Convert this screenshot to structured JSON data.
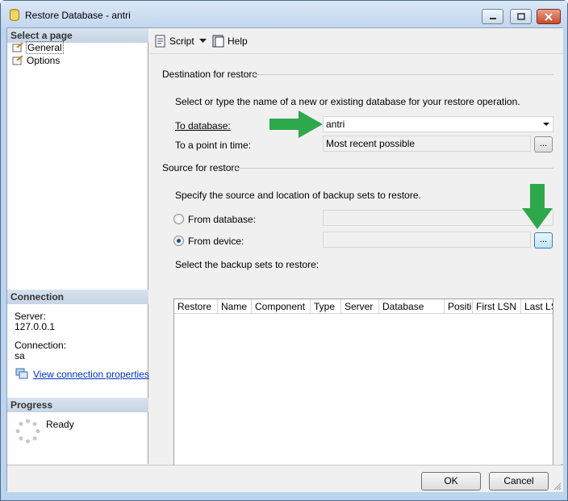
{
  "window": {
    "title": "Restore Database - antri"
  },
  "sidebar": {
    "select_page_header": "Select a page",
    "items": [
      {
        "label": "General"
      },
      {
        "label": "Options"
      }
    ],
    "connection_header": "Connection",
    "server_label": "Server:",
    "server_value": "127.0.0.1",
    "connection_label": "Connection:",
    "connection_value": "sa",
    "view_props_link": "View connection properties",
    "progress_header": "Progress",
    "progress_status": "Ready"
  },
  "toolbar": {
    "script_label": "Script",
    "help_label": "Help"
  },
  "destination": {
    "group_title": "Destination for restore",
    "instruction": "Select or type the name of a new or existing database for your restore operation.",
    "to_database_label": "To database:",
    "to_database_value": "antri",
    "point_in_time_label": "To a point in time:",
    "point_in_time_value": "Most recent possible"
  },
  "source": {
    "group_title": "Source for restore",
    "instruction": "Specify the source and location of backup sets to restore.",
    "from_database_label": "From database:",
    "from_device_label": "From device:",
    "selected_option": "From device",
    "backup_sets_label": "Select the backup sets to restore:",
    "columns": [
      "Restore",
      "Name",
      "Component",
      "Type",
      "Server",
      "Database",
      "Position",
      "First LSN",
      "Last LS"
    ],
    "rows": []
  },
  "buttons": {
    "ok": "OK",
    "cancel": "Cancel",
    "browse": "..."
  },
  "colors": {
    "arrow": "#2da84a",
    "accent": "#0033cc"
  }
}
